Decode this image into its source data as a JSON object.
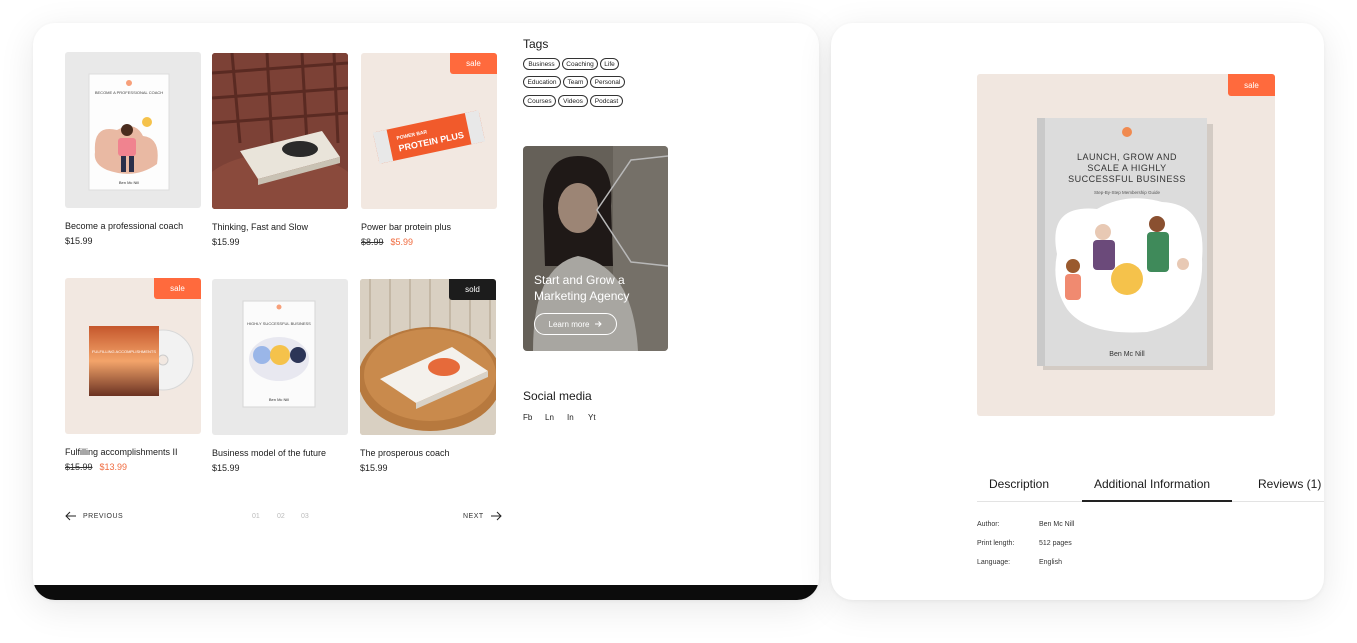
{
  "products": [
    {
      "title": "Become a professional coach",
      "price": "$15.99",
      "badge": ""
    },
    {
      "title": "Thinking, Fast and Slow",
      "price": "$15.99",
      "badge": ""
    },
    {
      "title": "Power bar protein plus",
      "old_price": "$8.99",
      "new_price": "$5.99",
      "badge": "sale"
    },
    {
      "title": "Fulfilling accomplishments II",
      "old_price": "$15.99",
      "new_price": "$13.99",
      "badge": "sale"
    },
    {
      "title": "Business model of the future",
      "price": "$15.99",
      "badge": ""
    },
    {
      "title": "The prosperous coach",
      "price": "$15.99",
      "badge": "sold"
    }
  ],
  "product_images": {
    "coach_book": {
      "heading": "BECOME A PROFESSIONAL COACH",
      "author": "Ben Mc Nill"
    },
    "protein_bar": {
      "brand": "POWER BAR",
      "product": "PROTEIN PLUS"
    },
    "cd": {
      "title": "FULFILLING ACCOMPLISHMENTS"
    },
    "business_book": {
      "heading": "HIGHLY SUCCESSFUL BUSINESS",
      "author": "Ben Mc Nill"
    }
  },
  "pagination": {
    "previous": "PREVIOUS",
    "next": "NEXT",
    "pages": [
      "01",
      "02",
      "03"
    ]
  },
  "tags": {
    "title": "Tags",
    "items": [
      "Business",
      "Coaching",
      "Life",
      "Education",
      "Team",
      "Personal",
      "Courses",
      "Videos",
      "Podcast"
    ]
  },
  "promo": {
    "title": "Start and Grow a Marketing Agency",
    "button": "Learn more"
  },
  "social": {
    "title": "Social media",
    "items": [
      "Fb",
      "Ln",
      "In",
      "Yt"
    ]
  },
  "detail": {
    "badge": "sale",
    "book": {
      "title": "LAUNCH, GROW AND SCALE A HIGHLY SUCCESSFUL BUSINESS",
      "subtitle": "Step-By-Step Membership Guide",
      "author": "Ben Mc Nill"
    },
    "tabs": [
      "Description",
      "Additional Information",
      "Reviews (1)"
    ],
    "active_tab": "Additional Information",
    "info": [
      {
        "label": "Author:",
        "value": "Ben Mc Nill"
      },
      {
        "label": "Print length:",
        "value": "512 pages"
      },
      {
        "label": "Language:",
        "value": "English"
      }
    ]
  },
  "colors": {
    "accent": "#ff6a3d",
    "sold": "#1c1c1c"
  }
}
